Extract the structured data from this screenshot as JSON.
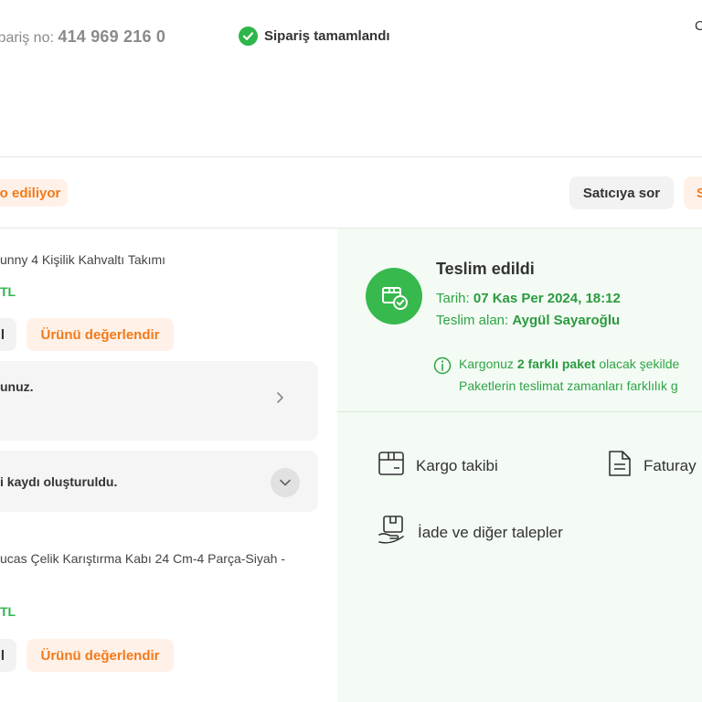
{
  "header": {
    "order_label": "ipariş no:",
    "order_number": "414 969 216 0",
    "status_text": "Sipariş tamamlandı",
    "corner_char": "C"
  },
  "shipment_bar": {
    "status_pill": "o ediliyor",
    "ask_seller": "Satıcıya sor",
    "partial_button": "S"
  },
  "products": [
    {
      "title": "unny 4 Kişilik Kahvaltı Takımı",
      "price_fragment": "TL",
      "left_button_fragment": "l",
      "review_button": "Ürünü değerlendir"
    },
    {
      "title": "ucas Çelik Karıştırma Kabı 24 Cm-4 Parça-Siyah -",
      "price_fragment": "TL",
      "left_button_fragment": "l",
      "review_button": "Ürünü değerlendir"
    }
  ],
  "info_cards": [
    {
      "text": "unuz.",
      "icon": "chevron-right-icon"
    },
    {
      "text": "i kaydı oluşturuldu.",
      "icon": "chevron-down-icon"
    }
  ],
  "delivery": {
    "title": "Teslim edildi",
    "date_label": "Tarih:",
    "date_value": "07 Kas Per 2024, 18:12",
    "receiver_label": "Teslim alan:",
    "receiver_value": "Aygül Sayaroğlu",
    "note_prefix": "Kargonuz",
    "note_bold": "2 farklı paket",
    "note_suffix": "olacak şekilde",
    "note_line2": "Paketlerin teslimat zamanları farklılık g"
  },
  "actions": {
    "cargo_tracking": "Kargo takibi",
    "invoice": "Faturay",
    "returns": "İade ve diğer talepler"
  },
  "colors": {
    "accent_orange": "#f27a1a",
    "success_green": "#2fb64a",
    "panel_green": "#f3fbf4"
  }
}
